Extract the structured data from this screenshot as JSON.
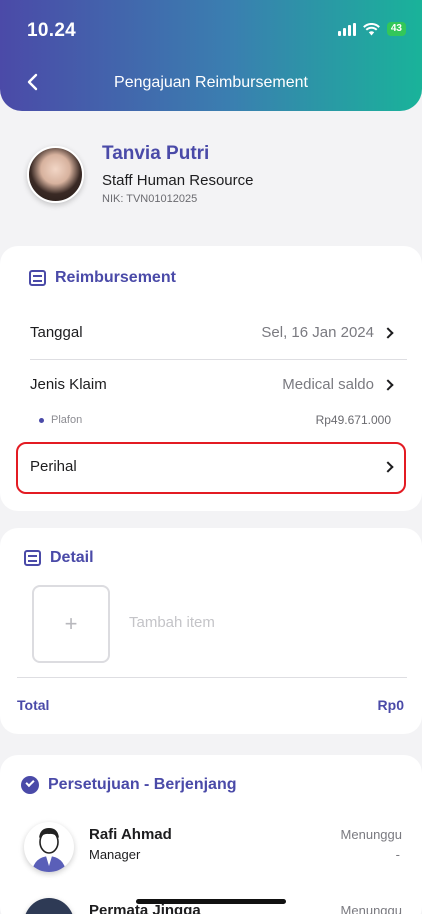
{
  "status_bar": {
    "time": "10.24",
    "battery": "43"
  },
  "header": {
    "title": "Pengajuan Reimbursement"
  },
  "profile": {
    "name": "Tanvia Putri",
    "role": "Staff Human Resource",
    "nik": "NIK: TVN01012025"
  },
  "reimbursement": {
    "title": "Reimbursement",
    "tanggal_label": "Tanggal",
    "tanggal_value": "Sel, 16 Jan 2024",
    "jenis_label": "Jenis Klaim",
    "jenis_value": "Medical saldo",
    "plafon_label": "Plafon",
    "plafon_value": "Rp49.671.000",
    "perihal_label": "Perihal"
  },
  "detail": {
    "title": "Detail",
    "add_icon": "+",
    "add_hint": "Tambah item",
    "total_label": "Total",
    "total_value": "Rp0"
  },
  "approval": {
    "title": "Persetujuan - Berjenjang",
    "approvers": [
      {
        "name": "Rafi Ahmad",
        "role": "Manager",
        "status": "Menunggu",
        "date": "-"
      },
      {
        "name": "Permata Jingga",
        "role": "",
        "status": "Menunggu",
        "date": ""
      }
    ]
  },
  "colors": {
    "accent": "#4a4aa8",
    "highlight": "#e31b23"
  }
}
